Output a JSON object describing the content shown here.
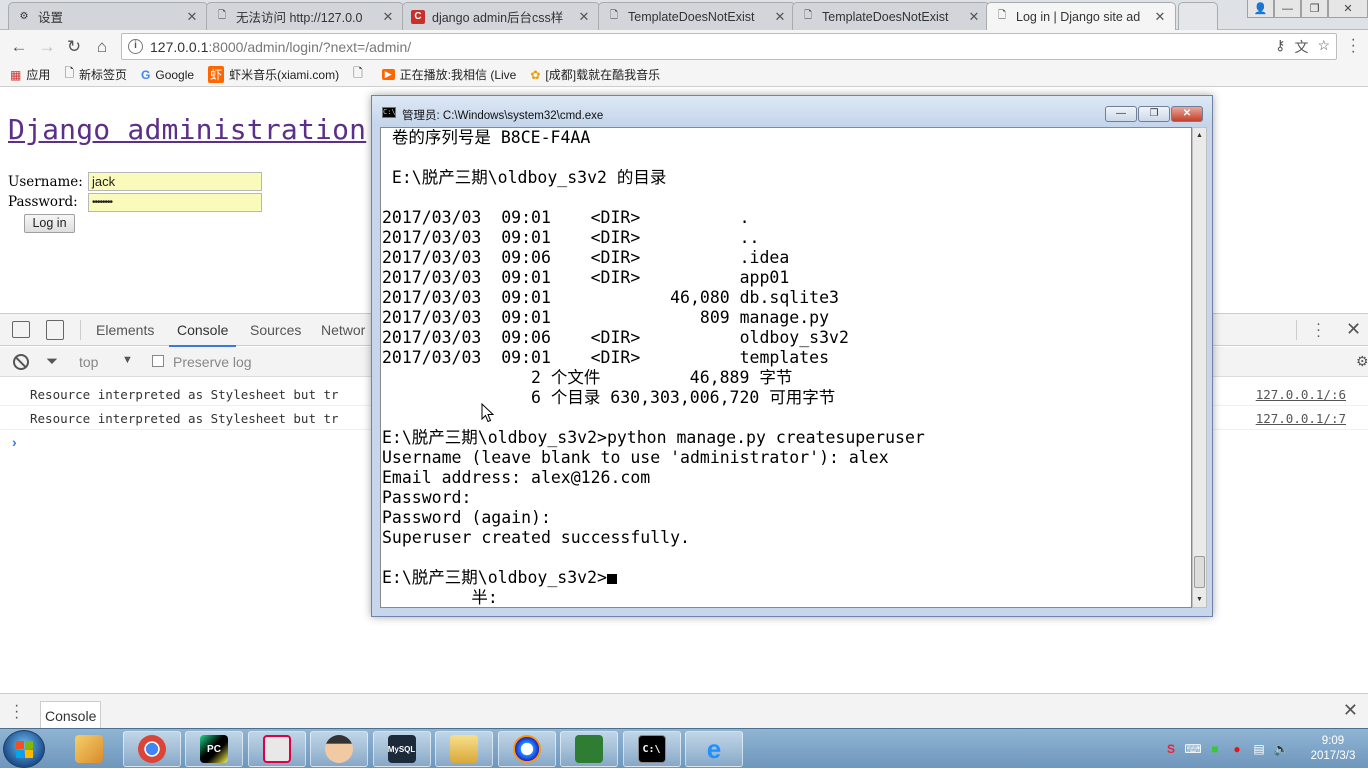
{
  "browser": {
    "tabs": [
      {
        "title": "设置",
        "icon": "gear-icon"
      },
      {
        "title": "无法访问 http://127.0.0",
        "icon": "page-icon"
      },
      {
        "title": "django admin后台css样",
        "icon": "csdn-icon"
      },
      {
        "title": "TemplateDoesNotExist",
        "icon": "page-icon"
      },
      {
        "title": "TemplateDoesNotExist",
        "icon": "page-icon"
      },
      {
        "title": "Log in | Django site ad",
        "icon": "page-icon",
        "active": true
      }
    ],
    "url_host": "127.0.0.1",
    "url_path": ":8000/admin/login/?next=/admin/",
    "bookmarks": [
      {
        "label": "应用",
        "icon": "apps-grid-icon"
      },
      {
        "label": "新标签页",
        "icon": "page-icon"
      },
      {
        "label": "Google",
        "icon": "google-icon"
      },
      {
        "label": "虾米音乐(xiami.com)",
        "icon": "xiami-icon"
      },
      {
        "label": "",
        "icon": "page-icon"
      },
      {
        "label": "正在播放:我相信 (Live",
        "icon": "play-icon"
      },
      {
        "label": "[成都]载就在酷我音乐",
        "icon": "kuwo-icon"
      }
    ]
  },
  "page": {
    "site_title": "Django administration",
    "username_label": "Username:",
    "username_value": "jack",
    "password_label": "Password:",
    "password_value": "••••••••",
    "login_button": "Log in"
  },
  "devtools": {
    "tabs": [
      "Elements",
      "Console",
      "Sources",
      "Networ"
    ],
    "active_tab": "Console",
    "context": "top",
    "preserve_log_label": "Preserve log",
    "messages": [
      {
        "text": "Resource interpreted as Stylesheet but tr",
        "source": "127.0.0.1/:6"
      },
      {
        "text": "Resource interpreted as Stylesheet but tr",
        "source": "127.0.0.1/:7"
      }
    ],
    "drawer_tab": "Console"
  },
  "cmd": {
    "title": "管理员: C:\\Windows\\system32\\cmd.exe",
    "lines": [
      " 卷的序列号是 B8CE-F4AA",
      "",
      " E:\\脱产三期\\oldboy_s3v2 的目录",
      "",
      "2017/03/03  09:01    <DIR>          .",
      "2017/03/03  09:01    <DIR>          ..",
      "2017/03/03  09:06    <DIR>          .idea",
      "2017/03/03  09:01    <DIR>          app01",
      "2017/03/03  09:01            46,080 db.sqlite3",
      "2017/03/03  09:01               809 manage.py",
      "2017/03/03  09:06    <DIR>          oldboy_s3v2",
      "2017/03/03  09:01    <DIR>          templates",
      "               2 个文件         46,889 字节",
      "               6 个目录 630,303,006,720 可用字节",
      "",
      "E:\\脱产三期\\oldboy_s3v2>python manage.py createsuperuser",
      "Username (leave blank to use 'administrator'): alex",
      "Email address: alex@126.com",
      "Password:",
      "Password (again):",
      "Superuser created successfully.",
      "",
      "E:\\脱产三期\\oldboy_s3v2>",
      "         半:"
    ]
  },
  "taskbar": {
    "apps": [
      {
        "name": "paint-icon",
        "label": ""
      },
      {
        "name": "chrome-icon",
        "label": ""
      },
      {
        "name": "pycharm-icon",
        "label": "PC"
      },
      {
        "name": "presentation-icon",
        "label": ""
      },
      {
        "name": "avatar-icon",
        "label": ""
      },
      {
        "name": "mysql-icon",
        "label": "MySQL"
      },
      {
        "name": "folder-icon",
        "label": ""
      },
      {
        "name": "chat-icon",
        "label": ""
      },
      {
        "name": "chart-app-icon",
        "label": ""
      },
      {
        "name": "cmd-icon",
        "label": "C:\\"
      },
      {
        "name": "ie-icon",
        "label": "e"
      }
    ],
    "time": "9:09",
    "date": "2017/3/3"
  }
}
